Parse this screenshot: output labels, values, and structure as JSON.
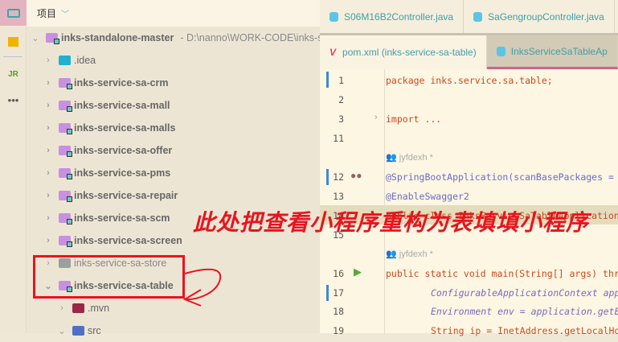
{
  "toolbar": {
    "items": [
      "project-icon",
      "structure-icon",
      "jrebel-icon",
      "more-icon"
    ],
    "more": "•••"
  },
  "panel": {
    "title": "项目",
    "root": {
      "name": "inks-standalone-master",
      "path": "- D:\\nanno\\WORK-CODE\\inks-sta"
    },
    "items": [
      ".idea",
      "inks-service-sa-crm",
      "inks-service-sa-mall",
      "inks-service-sa-malls",
      "inks-service-sa-offer",
      "inks-service-sa-pms",
      "inks-service-sa-repair",
      "inks-service-sa-scm",
      "inks-service-sa-screen",
      "inks-service-sa-store",
      "inks-service-sa-table"
    ],
    "children": [
      ".mvn",
      "src"
    ]
  },
  "editor": {
    "tabs_top": [
      "S06M16B2Controller.java",
      "SaGengroupController.java"
    ],
    "tabs": [
      "pom.xml (inks-service-sa-table)",
      "InksServiceSaTableAp"
    ],
    "author": "jyfdexh *",
    "lines": [
      {
        "n": "1",
        "t": "package inks.service.sa.table;"
      },
      {
        "n": "2",
        "t": ""
      },
      {
        "n": "3",
        "t": "import ..."
      },
      {
        "n": "11",
        "t": ""
      },
      {
        "n": "12",
        "t": "@SpringBootApplication(scanBasePackages = "
      },
      {
        "n": "13",
        "t": "@EnableSwagger2"
      },
      {
        "n": "14",
        "t": "public class InksServiceSaTableApplication"
      },
      {
        "n": "15",
        "t": ""
      },
      {
        "n": "16",
        "t": "public static void main(String[] args) thr"
      },
      {
        "n": "17",
        "t": "ConfigurableApplicationContext app"
      },
      {
        "n": "18",
        "t": "Environment env = application.getE"
      },
      {
        "n": "19",
        "t": "String ip = InetAddress.getLocalHo"
      }
    ]
  },
  "annotation": {
    "text": "此处把查看小程序重构为表填填小程序",
    "color": "#e8141e"
  }
}
